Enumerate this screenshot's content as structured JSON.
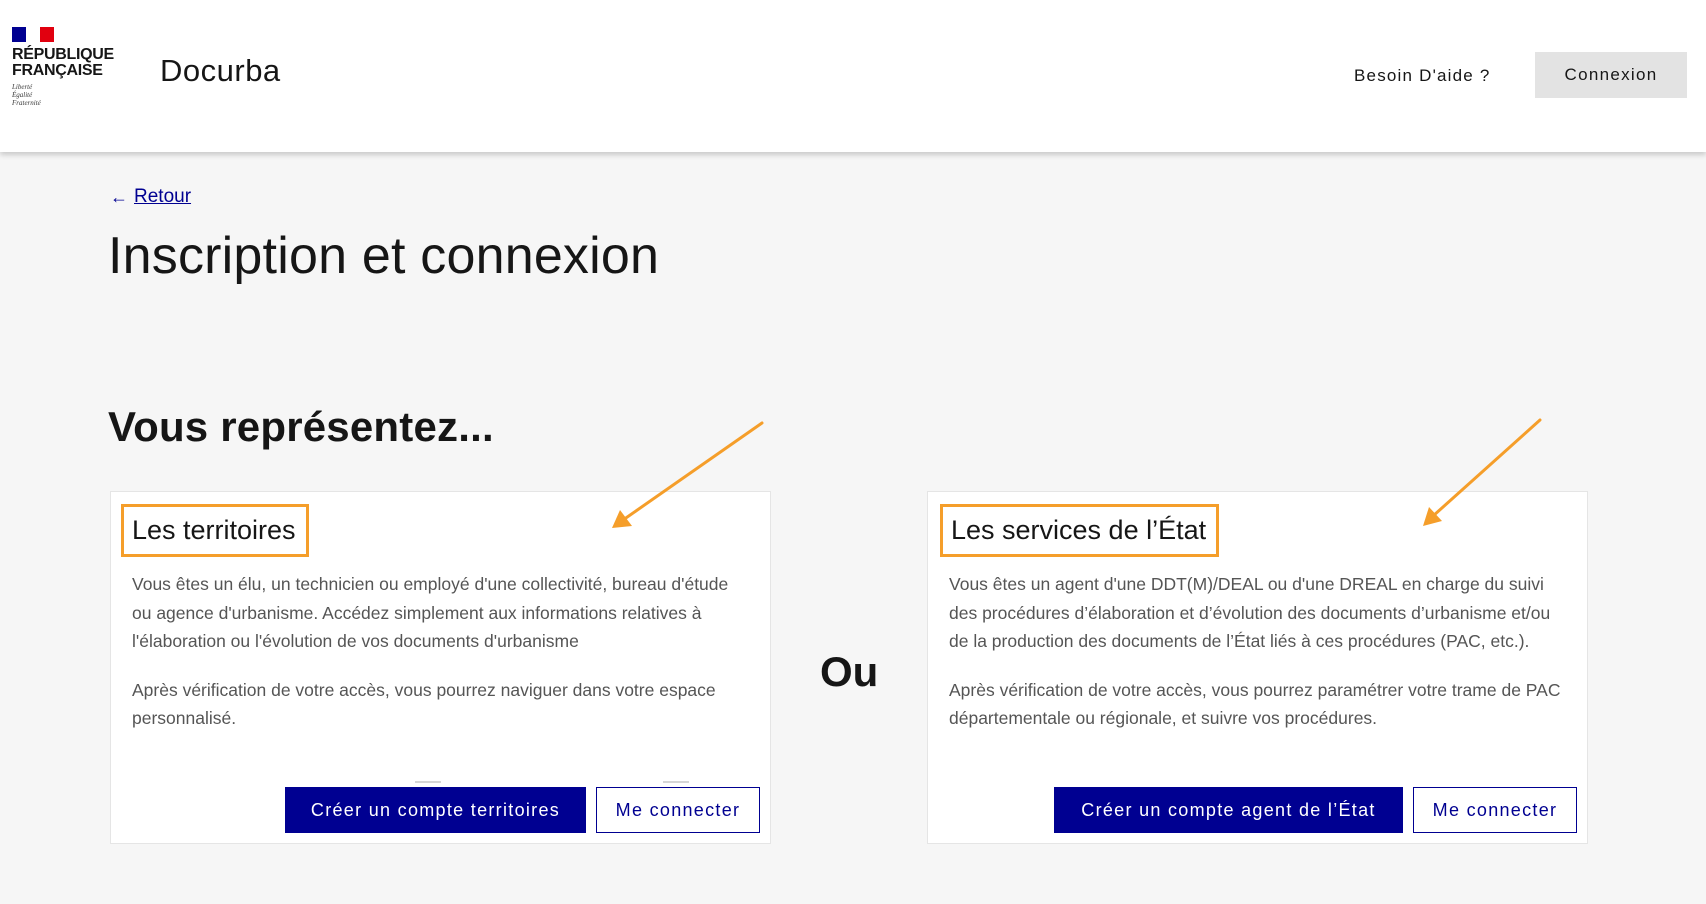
{
  "header": {
    "logo": {
      "name": "RÉPUBLIQUE\nFRANÇAISE",
      "motto": "Liberté\nÉgalité\nFraternité",
      "flag_colors": [
        "#000091",
        "#ffffff",
        "#e1000f"
      ]
    },
    "service_name": "Docurba",
    "help_link": "Besoin D'aide ?",
    "login_button": "Connexion"
  },
  "main": {
    "back_link": "Retour",
    "back_icon": "arrow-left-icon",
    "title": "Inscription et connexion",
    "section_title": "Vous représentez...",
    "separator": "Ou",
    "cards": [
      {
        "title": "Les territoires",
        "description_1": "Vous êtes un élu, un technicien ou employé d'une collectivité, bureau d'étude ou agence d'urbanisme. Accédez simplement aux informations relatives à l'élaboration ou l'évolution de vos documents d'urbanisme",
        "description_2": "Après vérification de votre accès, vous pourrez naviguer dans votre espace personnalisé.",
        "primary_button": "Créer un compte territoires",
        "secondary_button": "Me connecter"
      },
      {
        "title": "Les services de l’État",
        "description_1": "Vous êtes un agent d'une DDT(M)/DEAL ou d'une DREAL en charge du suivi des procédures d’élaboration et d’évolution des documents d’urbanisme et/ou de la production des documents de l’État liés à ces procédures (PAC, etc.).",
        "description_2": "Après vérification de votre accès, vous pourrez paramétrer votre trame de PAC départementale ou régionale, et suivre vos procédures.",
        "primary_button": "Créer un compte agent de l’État",
        "secondary_button": "Me connecter"
      }
    ]
  },
  "colors": {
    "primary_blue": "#000091",
    "annotation_orange": "#f59e2a",
    "page_bg": "#f6f6f6"
  }
}
